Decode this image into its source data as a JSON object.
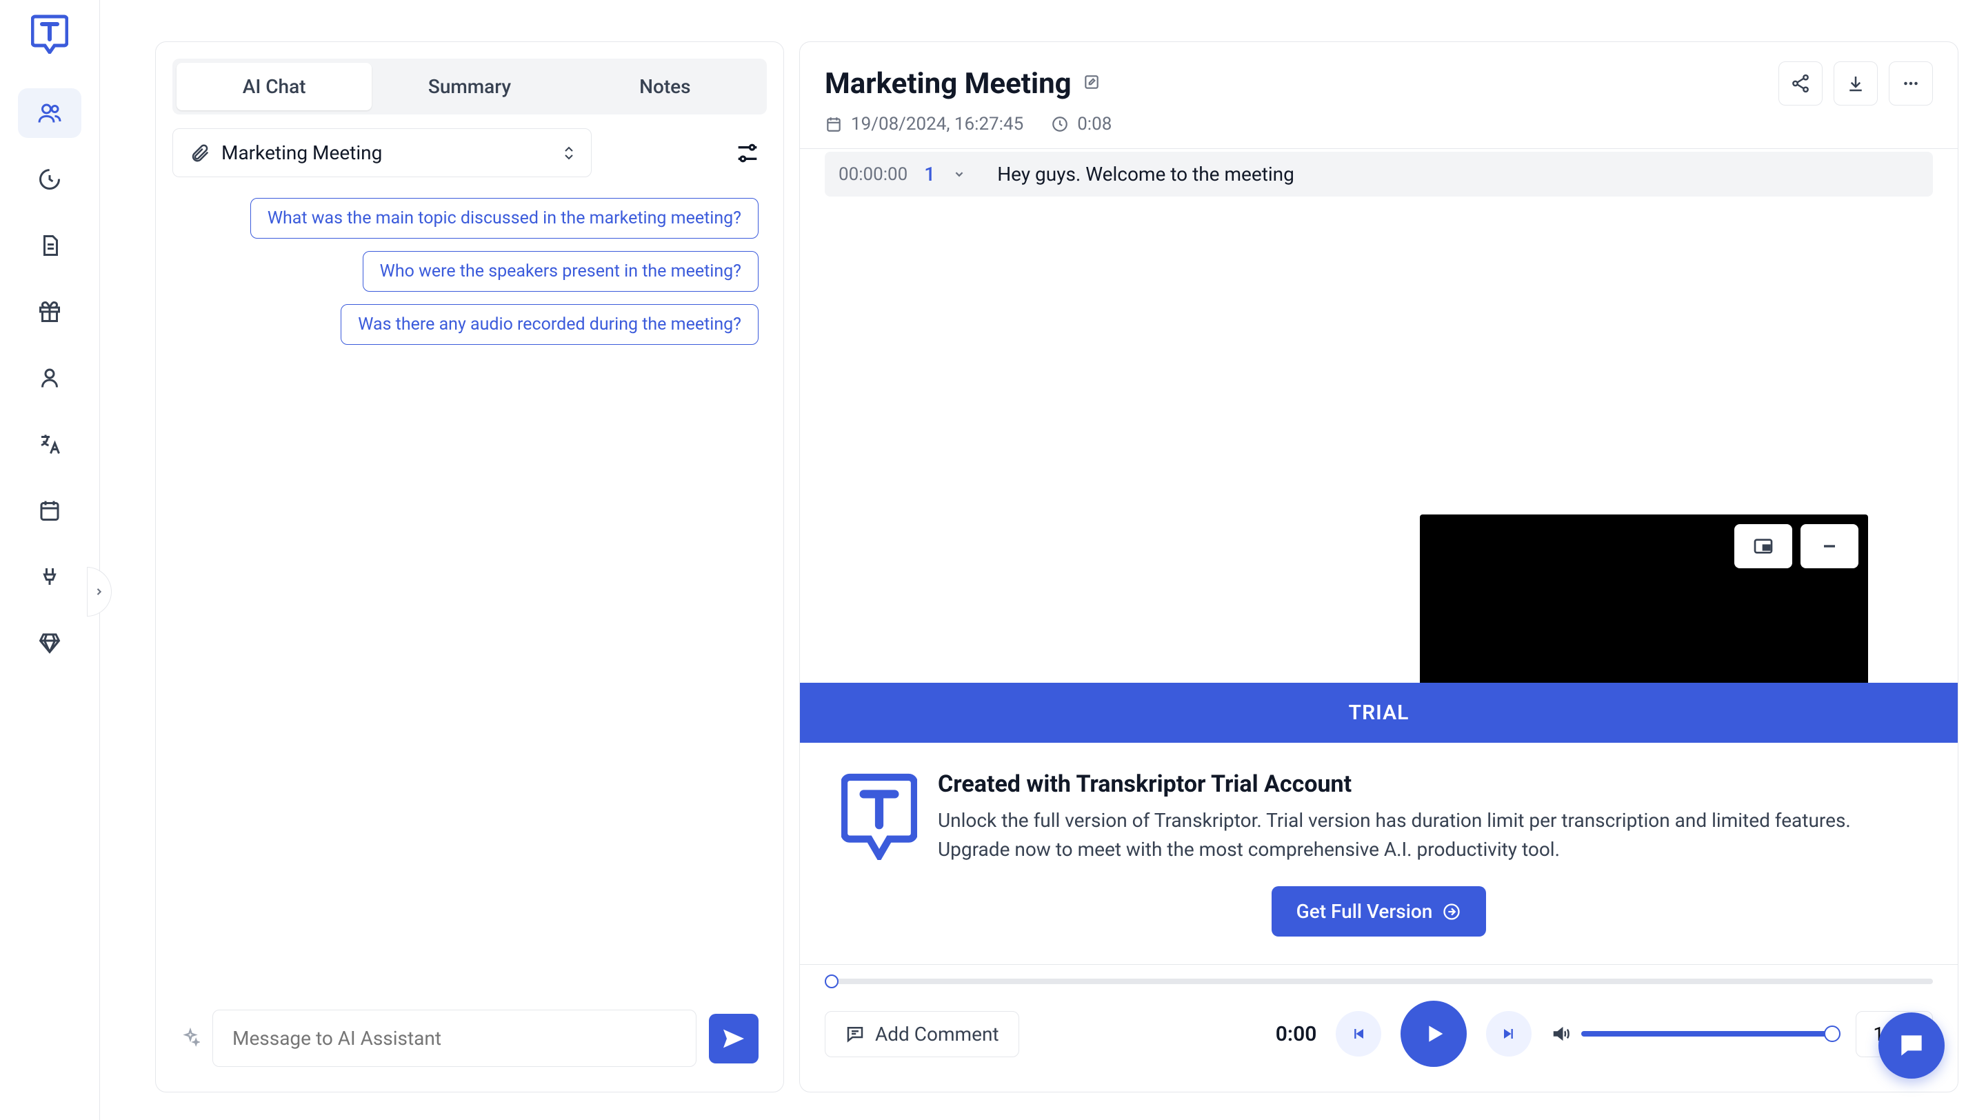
{
  "sidebar": {
    "nav": [
      "team",
      "activity",
      "documents",
      "gift",
      "user",
      "language",
      "calendar",
      "integration",
      "premium"
    ]
  },
  "left": {
    "tabs": [
      {
        "id": "ai-chat",
        "label": "AI Chat",
        "active": true
      },
      {
        "id": "summary",
        "label": "Summary",
        "active": false
      },
      {
        "id": "notes",
        "label": "Notes",
        "active": false
      }
    ],
    "selector": {
      "label": "Marketing Meeting"
    },
    "chips": [
      "What was the main topic discussed in the marketing meeting?",
      "Who were the speakers present in the meeting?",
      "Was there any audio recorded during the meeting?"
    ],
    "composer_placeholder": "Message to AI Assistant"
  },
  "right": {
    "title": "Marketing Meeting",
    "date": "19/08/2024, 16:27:45",
    "duration": "0:08",
    "transcript": [
      {
        "time": "00:00:00",
        "speaker": "1",
        "text": "Hey guys. Welcome to the meeting"
      }
    ],
    "trial": {
      "banner": "TRIAL",
      "heading": "Created with Transkriptor Trial Account",
      "body": "Unlock the full version of Transkriptor. Trial version has duration limit per transcription and limited features. Upgrade now to meet with the most comprehensive A.I. productivity tool.",
      "cta": "Get Full Version"
    },
    "player": {
      "add_comment": "Add Comment",
      "time": "0:00",
      "speed": "1x"
    }
  }
}
